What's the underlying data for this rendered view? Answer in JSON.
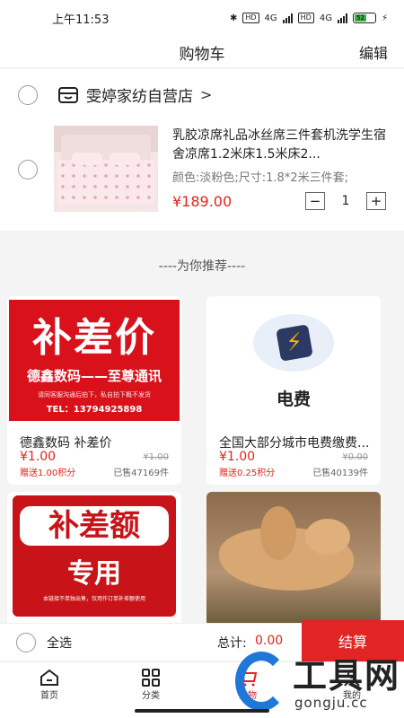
{
  "status_bar": {
    "time": "上午11:53",
    "net1": "4G",
    "net2": "4G",
    "hd": "HD",
    "battery": "52"
  },
  "header": {
    "title": "购物车",
    "edit": "编辑"
  },
  "cart": {
    "store_name": "雯婷家纺自营店",
    "store_chevron": ">",
    "item": {
      "title": "乳胶凉席礼品冰丝席三件套机洗学生宿舍凉席1.2米床1.5米床2...",
      "spec": "颜色:淡粉色;尺寸:1.8*2米三件套;",
      "price": "¥189.00",
      "qty": "1",
      "minus": "−",
      "plus": "+"
    }
  },
  "recommend": {
    "title": "----为你推荐----",
    "items": [
      {
        "name": "德鑫数码 补差价",
        "price": "¥1.00",
        "orig": "¥1.00",
        "points": "赠送1.00积分",
        "sold": "已售47169件",
        "img_big": "补差价",
        "img_mid": "德鑫数码——至尊通讯",
        "img_small": "请同客服沟通后拍下，私自拍下概不发货",
        "img_tel": "TEL：13794925898"
      },
      {
        "name": "全国大部分城市电费缴费...",
        "price": "¥1.00",
        "orig": "¥0.00",
        "points": "赠送0.25积分",
        "sold": "已售40139件",
        "img_label": "电费"
      },
      {
        "name": "",
        "img_b1": "补差额",
        "img_b2": "专用",
        "img_tiny": "本链接不单独出售，仅用作订单补差额使用"
      },
      {
        "name": ""
      }
    ]
  },
  "checkout": {
    "select_all": "全选",
    "total_label": "总计:",
    "total_value": "0.00",
    "pay": "结算"
  },
  "tabbar": [
    {
      "label": "首页",
      "icon": "home-icon"
    },
    {
      "label": "分类",
      "icon": "grid-icon"
    },
    {
      "label": "购物",
      "icon": "cart-icon"
    },
    {
      "label": "我的",
      "icon": "user-icon"
    }
  ],
  "watermark": {
    "text": "工具网",
    "url": "gongju.cc"
  },
  "colors": {
    "accent": "#e22424",
    "price": "#e1251b",
    "brand_blue": "#1e78d7"
  }
}
